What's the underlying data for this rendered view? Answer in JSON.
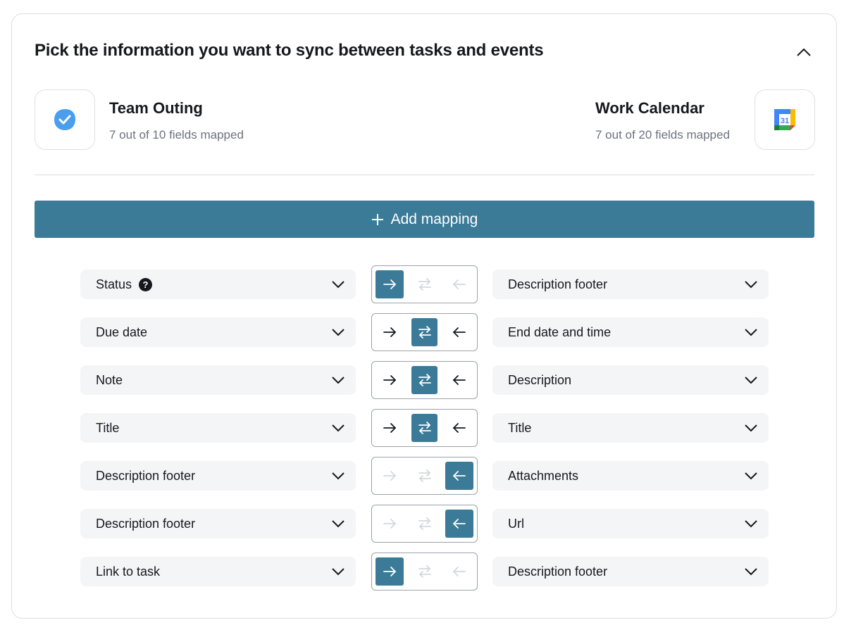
{
  "header": {
    "title": "Pick the information you want to sync between tasks and events"
  },
  "source_app": {
    "name": "Team Outing",
    "fields_mapped": "7 out of 10 fields mapped",
    "icon": "blue-check-icon"
  },
  "target_app": {
    "name": "Work Calendar",
    "fields_mapped": "7 out of 20 fields mapped",
    "icon": "google-calendar-icon",
    "icon_text": "31"
  },
  "add_mapping": {
    "label": "Add mapping"
  },
  "colors": {
    "accent": "#3b7b98",
    "muted_arrow": "#d4d7db",
    "text": "#15181d"
  },
  "mappings": [
    {
      "left": "Status",
      "right": "Description footer",
      "direction": "right",
      "help": "?"
    },
    {
      "left": "Due date",
      "right": "End date and time",
      "direction": "both"
    },
    {
      "left": "Note",
      "right": "Description",
      "direction": "both"
    },
    {
      "left": "Title",
      "right": "Title",
      "direction": "both"
    },
    {
      "left": "Description footer",
      "right": "Attachments",
      "direction": "left"
    },
    {
      "left": "Description footer",
      "right": "Url",
      "direction": "left"
    },
    {
      "left": "Link to task",
      "right": "Description footer",
      "direction": "right"
    }
  ]
}
